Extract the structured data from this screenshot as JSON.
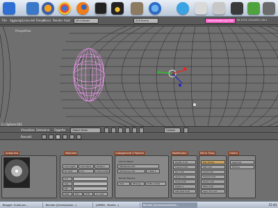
{
  "dock": {
    "icons": [
      "kde-icon",
      "home-icon",
      "firefox-icon",
      "chrome-icon",
      "blender-icon",
      "terminal-icon",
      "tux-icon",
      "gimp-icon",
      "globe-icon",
      "skype-icon",
      "email-icon",
      "settings-icon"
    ]
  },
  "blender_menu": {
    "items": [
      "File",
      "Aggiungi",
      "Linea del Tempo",
      "Gioco",
      "Render",
      "Aiuti"
    ],
    "screen_field": "SR:2-Model",
    "scene_field": "SCE:Scene",
    "url_field": "www.blender.org 249",
    "stats": "Ve:1074 | Fa:1035 | Ob:1"
  },
  "window": {
    "title": "Blender [/home/paolo/Desktop/tutorial.blend]",
    "viewport_label": "Prospettiva",
    "object_label": "(1) Sphere.001"
  },
  "view_header": {
    "menus": [
      "Visualizza",
      "Selezione",
      "Oggetto"
    ],
    "mode": "Object Mode",
    "transform": "Globale"
  },
  "buttons_header": {
    "menus": [
      "Pannelli"
    ]
  },
  "buttons_window": {
    "tabs": [
      "Anteprima",
      "Materiale",
      "Collegamenti e Pipeline",
      "Modificatori",
      "Mirror Trasp",
      "Ombre"
    ],
    "material_panel": {
      "title": "Materiale",
      "rows": [
        "VCol Light",
        "VCol Paint",
        "TexFace",
        "No Mist",
        "Env",
        "Shad 0.000"
      ]
    },
    "links_panel": {
      "title": "Collegamenti e Pipeline",
      "link_label": "Link to Object",
      "me_field": "ME:Sphere.001",
      "ob_field": "OB:Sphere.001",
      "mat_field": "1 Mat 1",
      "render_pipeline": "Render Pipeline",
      "pipeline_buttons": [
        "Halo",
        "ZTransp",
        "Zoffs: 0.000"
      ]
    },
    "shaders_panel": {
      "title": "Shaders",
      "rows": [
        "RayMir 0.00",
        "Fresnel 0.00",
        "Fac 1.25",
        "Gloss 1.00",
        "Aniso 0.00",
        "Depth 2",
        "Max Dist 0.00"
      ]
    },
    "transp_panel": {
      "title": "Mirror Transp",
      "rows": [
        "Ray Transp",
        "IOR 1.00",
        "Limit 0.00",
        "Fresnel 0.00",
        "Gloss 1.00",
        "Filter 0.00",
        "Spec Tra 1.00"
      ]
    },
    "shadow_panel": {
      "title": "Ombre",
      "rows": [
        "Aggiungi",
        "Elimina"
      ]
    },
    "color_rows": [
      "Col",
      "Spe",
      "Mir",
      "RGB",
      "HSV",
      "DYN",
      "A 1.000"
    ]
  },
  "taskbar": {
    "tasks": [
      "Blogger: Guide per...",
      "Blender [/home/paolo/...]",
      "[ARMIN - Mozilla...]",
      "Blender [/home/paolo/Desk..."
    ],
    "clock": "15:44"
  },
  "colors": {
    "viewport_bg": "#6f6f6f",
    "selected_mesh": "#ff9cff",
    "wire": "#1a1a1a",
    "url_field": "#ff66cc"
  }
}
